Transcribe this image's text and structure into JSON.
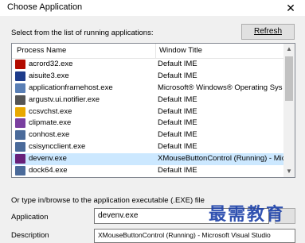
{
  "window": {
    "title": "Choose Application",
    "close_glyph": "✕"
  },
  "list_section": {
    "label": "Select from the list of running applications:",
    "refresh_label": "Refresh"
  },
  "columns": {
    "process": "Process Name",
    "window": "Window Title"
  },
  "rows": [
    {
      "name": "acrord32.exe",
      "window": "Default IME",
      "icon": "acrobat-icon",
      "color": "#b30b00",
      "selected": false
    },
    {
      "name": "aisuite3.exe",
      "window": "Default IME",
      "icon": "aisuite-icon",
      "color": "#1d3b8a",
      "selected": false
    },
    {
      "name": "applicationframehost.exe",
      "window": "Microsoft® Windows® Operating Sys",
      "icon": "app-frame-icon",
      "color": "#5a7fb5",
      "selected": false
    },
    {
      "name": "argustv.ui.notifier.exe",
      "window": "Default IME",
      "icon": "argus-icon",
      "color": "#555555",
      "selected": false
    },
    {
      "name": "ccsvchst.exe",
      "window": "Default IME",
      "icon": "checkmark-icon",
      "color": "#e8a800",
      "selected": false
    },
    {
      "name": "clipmate.exe",
      "window": "Default IME",
      "icon": "clipmate-icon",
      "color": "#7a3fa0",
      "selected": false
    },
    {
      "name": "conhost.exe",
      "window": "Default IME",
      "icon": "console-icon",
      "color": "#4a6a9a",
      "selected": false
    },
    {
      "name": "csisyncclient.exe",
      "window": "Default IME",
      "icon": "sync-icon",
      "color": "#4a6a9a",
      "selected": false
    },
    {
      "name": "devenv.exe",
      "window": "XMouseButtonControl (Running) - Mic",
      "icon": "visual-studio-icon",
      "color": "#68217a",
      "selected": true
    },
    {
      "name": "dock64.exe",
      "window": "Default IME",
      "icon": "dock-icon",
      "color": "#4a6a9a",
      "selected": false
    }
  ],
  "browse_section": {
    "label": "Or type in/browse to the application executable (.EXE) file",
    "application_label": "Application",
    "application_value": "devenv.exe",
    "description_label": "Description",
    "description_value": "XMouseButtonControl (Running) - Microsoft Visual Studio"
  },
  "watermark": "最需教育",
  "colors": {
    "selected_row": "#cce8ff",
    "background": "#f0f0f0",
    "watermark": "#1a3fa8"
  }
}
